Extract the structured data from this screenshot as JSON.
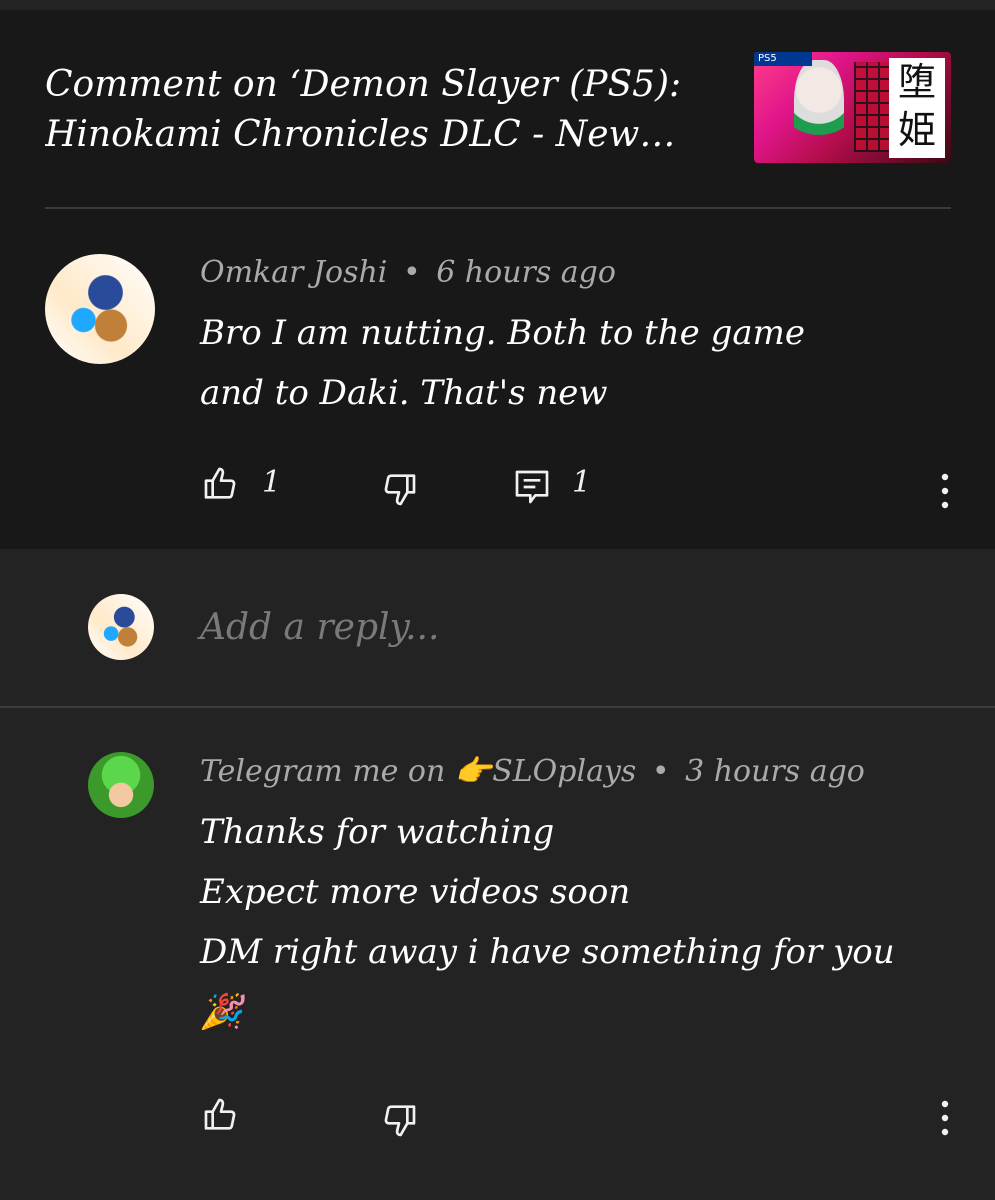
{
  "header": {
    "title": "Comment on ‘Demon Slayer (PS5): Hinokami Chronicles DLC - New Dak...",
    "thumbnail": {
      "badge": "PS5",
      "kanji": "堕姫"
    }
  },
  "comment": {
    "author": "Omkar Joshi",
    "time": "6 hours ago",
    "text_line1": "Bro I am nutting. Both to the game",
    "text_line2": "and to Daki. That's new",
    "likes": "1",
    "replies": "1"
  },
  "reply_box": {
    "placeholder": "Add a reply..."
  },
  "reply": {
    "author": "Telegram me on 👉SLOplays",
    "time": "3 hours ago",
    "line1": "Thanks for watching",
    "line2": "Expect more videos soon",
    "line3": "DM right away i have something for you",
    "line4": "🎉"
  },
  "separator": "•",
  "icons": [
    "like-icon",
    "dislike-icon",
    "reply-icon",
    "more-vert-icon"
  ],
  "colors": {
    "background": "#181818",
    "reply_background": "#232323",
    "meta_text": "#aaaaaa"
  }
}
